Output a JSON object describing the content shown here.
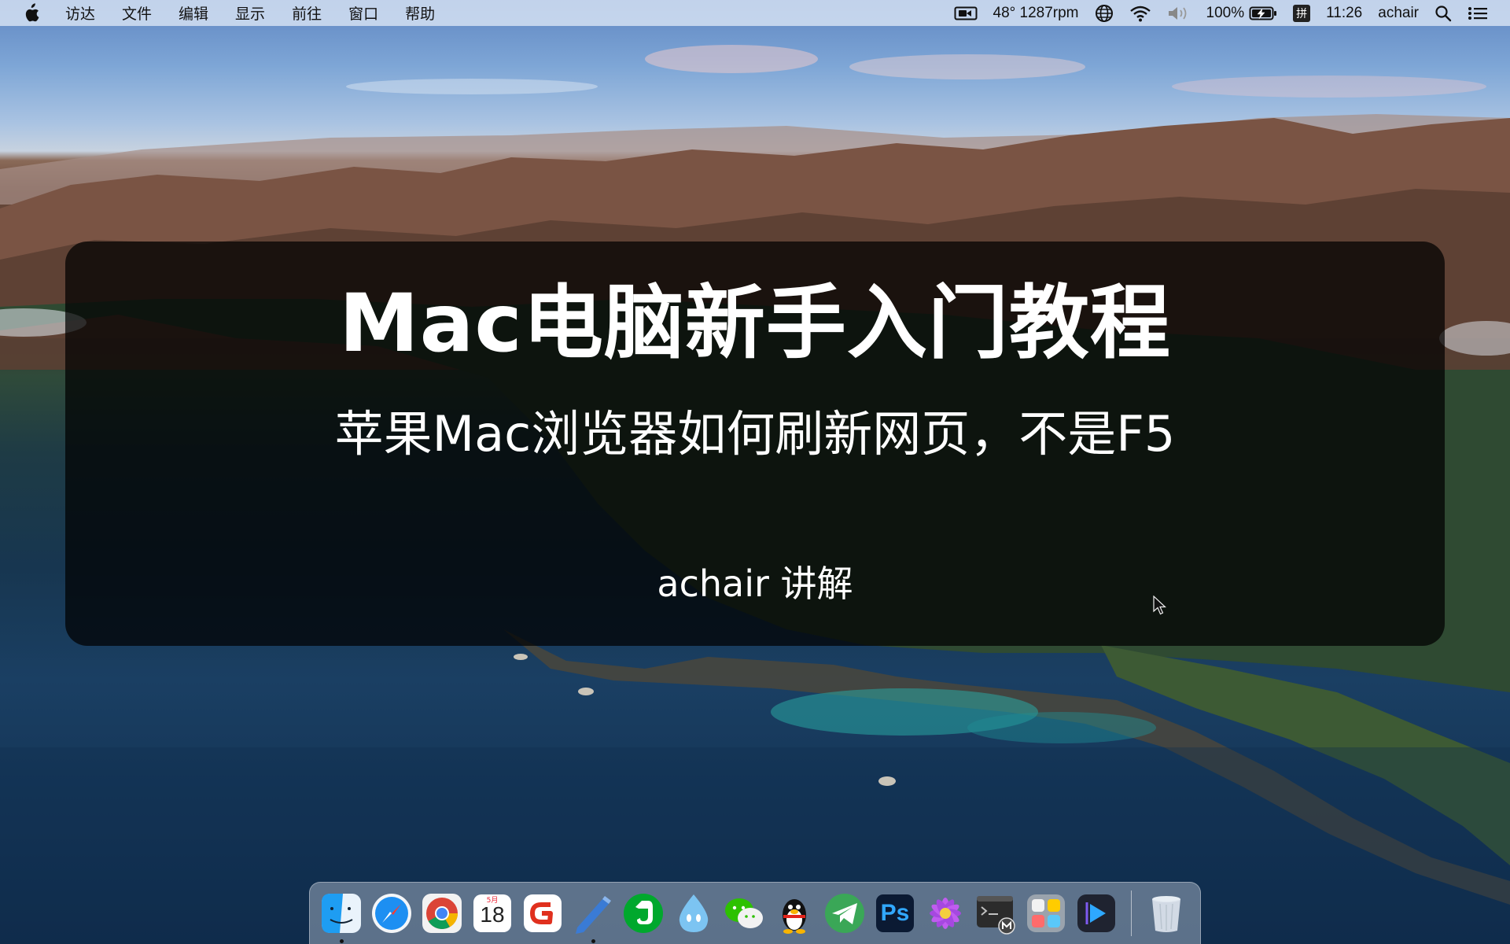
{
  "menubar": {
    "apple_icon": "apple-logo-icon",
    "menus": [
      "访达",
      "文件",
      "编辑",
      "显示",
      "前往",
      "窗口",
      "帮助"
    ],
    "status": {
      "screen_record_icon": "camera-icon",
      "sensor_text": "48° 1287rpm",
      "vpn_icon": "globe-icon",
      "wifi_icon": "wifi-icon",
      "volume_icon": "volume-muted-icon",
      "battery_text": "100%",
      "battery_icon": "battery-charging-icon",
      "ime_label": "拼",
      "time": "11:26",
      "user": "achair",
      "spotlight_icon": "search-icon",
      "control_center_icon": "list-icon"
    }
  },
  "overlay": {
    "title": "Mac电脑新手入门教程",
    "subtitle": "苹果Mac浏览器如何刷新网页，不是F5",
    "author": "achair 讲解"
  },
  "dock": {
    "apps": [
      {
        "name": "finder",
        "icon": "finder-icon",
        "running": true
      },
      {
        "name": "safari",
        "icon": "safari-compass-icon",
        "running": false
      },
      {
        "name": "chrome",
        "icon": "chrome-icon",
        "running": false
      },
      {
        "name": "calendar",
        "icon": "calendar-icon",
        "running": false,
        "month": "5月",
        "day": "18"
      },
      {
        "name": "g-app",
        "icon": "red-g-icon",
        "running": false
      },
      {
        "name": "notes-pen",
        "icon": "pen-icon",
        "running": true
      },
      {
        "name": "evernote",
        "icon": "evernote-elephant-icon",
        "running": false
      },
      {
        "name": "water-drop-app",
        "icon": "water-drop-icon",
        "running": false
      },
      {
        "name": "wechat",
        "icon": "wechat-icon",
        "running": false
      },
      {
        "name": "qq",
        "icon": "penguin-icon",
        "running": false
      },
      {
        "name": "telegram",
        "icon": "paper-plane-icon",
        "running": false
      },
      {
        "name": "photoshop",
        "icon": "photoshop-icon",
        "running": false,
        "label": "Ps"
      },
      {
        "name": "flower-app",
        "icon": "flower-icon",
        "running": false
      },
      {
        "name": "terminal-m",
        "icon": "terminal-icon",
        "running": false
      },
      {
        "name": "launcher",
        "icon": "app-grid-icon",
        "running": false
      },
      {
        "name": "video-player",
        "icon": "play-icon",
        "running": false
      },
      {
        "name": "trash",
        "icon": "trash-icon",
        "running": false
      }
    ]
  }
}
